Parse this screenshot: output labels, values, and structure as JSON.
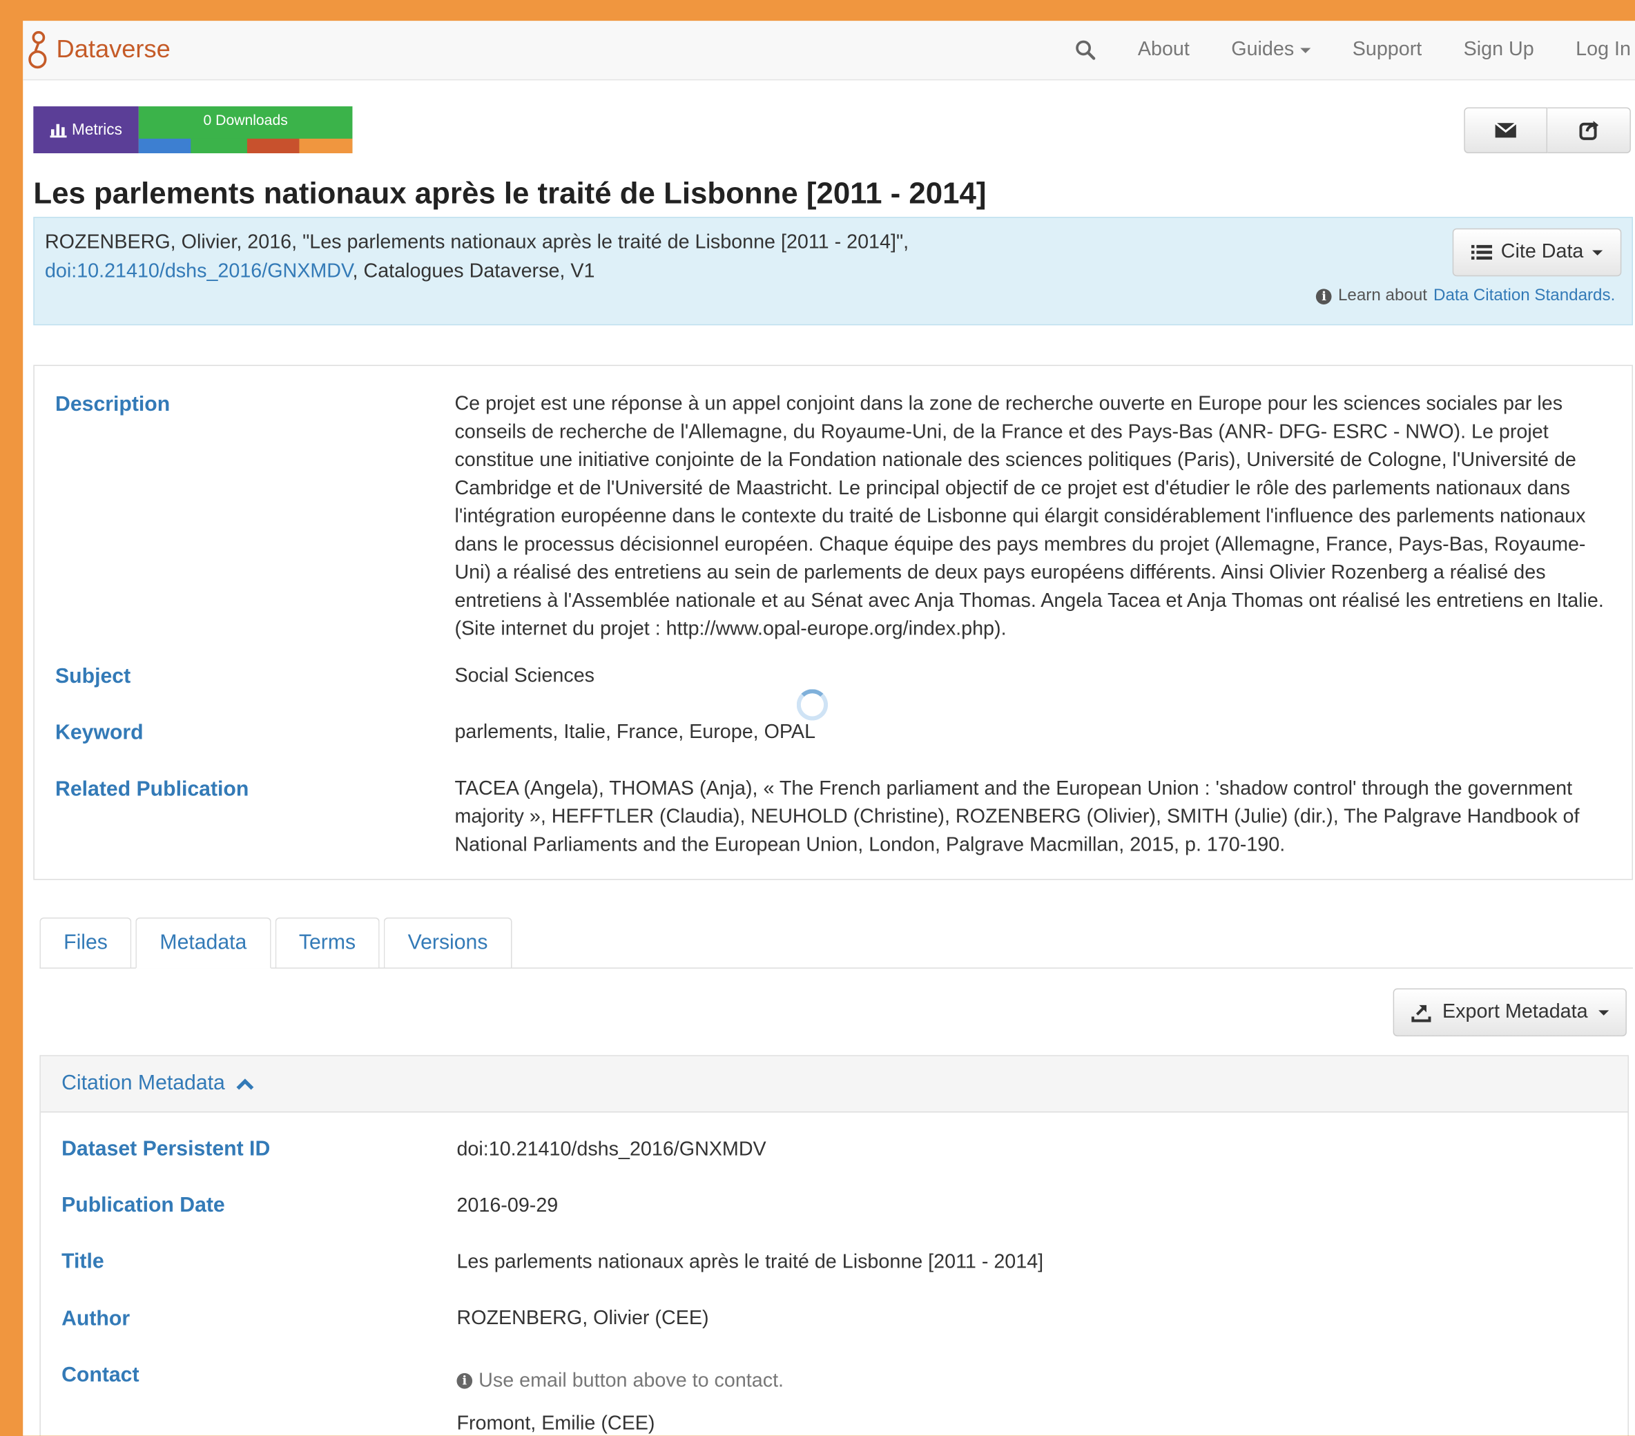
{
  "navbar": {
    "brand": "Dataverse",
    "items": [
      "About",
      "Guides",
      "Support",
      "Sign Up",
      "Log In"
    ]
  },
  "metrics": {
    "label": "Metrics",
    "downloads": "0 Downloads"
  },
  "dataset": {
    "title": "Les parlements nationaux après le traité de Lisbonne [2011 - 2014]"
  },
  "citation": {
    "line1": "ROZENBERG, Olivier, 2016, \"Les parlements nationaux après le traité de Lisbonne [2011 - 2014]\",",
    "doi_link": "doi:10.21410/dshs_2016/GNXMDV",
    "line2_rest": ", Catalogues Dataverse, V1",
    "cite_button": "Cite Data",
    "learn_prefix": "Learn about",
    "learn_link": "Data Citation Standards."
  },
  "summary": {
    "description_label": "Description",
    "description": "Ce projet est une réponse à un appel conjoint dans la zone de recherche ouverte en Europe pour les sciences sociales par les conseils de recherche de l'Allemagne, du Royaume-Uni, de la France et des Pays-Bas (ANR- DFG- ESRC - NWO). Le projet constitue une initiative conjointe de la Fondation nationale des sciences politiques (Paris), Université de Cologne, l'Université de Cambridge et de l'Université de Maastricht. Le principal objectif de ce projet est d'étudier le rôle des parlements nationaux dans l'intégration européenne dans le contexte du traité de Lisbonne qui élargit considérablement l'influence des parlements nationaux dans le processus décisionnel européen. Chaque équipe des pays membres du projet (Allemagne, France, Pays-Bas, Royaume-Uni) a réalisé des entretiens au sein de parlements de deux pays européens différents. Ainsi Olivier Rozenberg a réalisé des entretiens à l'Assemblée nationale et au Sénat avec Anja Thomas. Angela Tacea et Anja Thomas ont réalisé les entretiens en Italie. (Site internet du projet : http://www.opal-europe.org/index.php).",
    "subject_label": "Subject",
    "subject": "Social Sciences",
    "keyword_label": "Keyword",
    "keyword": "parlements, Italie, France, Europe, OPAL",
    "related_label": "Related Publication",
    "related": "TACEA (Angela), THOMAS (Anja), « The French parliament and the European Union : 'shadow control' through the government majority », HEFFTLER (Claudia), NEUHOLD (Christine), ROZENBERG (Olivier), SMITH (Julie) (dir.), The Palgrave Handbook of National Parliaments and the European Union, London, Palgrave Macmillan, 2015, p. 170-190."
  },
  "tabs": [
    "Files",
    "Metadata",
    "Terms",
    "Versions"
  ],
  "export_button": "Export Metadata",
  "citation_metadata": {
    "heading": "Citation Metadata",
    "rows": [
      {
        "label": "Dataset Persistent ID",
        "value": "doi:10.21410/dshs_2016/GNXMDV"
      },
      {
        "label": "Publication Date",
        "value": "2016-09-29"
      },
      {
        "label": "Title",
        "value": "Les parlements nationaux après le traité de Lisbonne [2011 - 2014]"
      },
      {
        "label": "Author",
        "value": "ROZENBERG, Olivier (CEE)"
      },
      {
        "label": "Contact",
        "value": "Use email button above to contact."
      }
    ],
    "contact_name": "Fromont, Emilie (CEE)"
  },
  "colors": {
    "background": "#f0963f",
    "brand": "#c55b28",
    "link": "#337ab7",
    "metrics_purple": "#5b3e97",
    "metrics_green": "#3bb34a",
    "citation_bg": "#def0f8"
  }
}
